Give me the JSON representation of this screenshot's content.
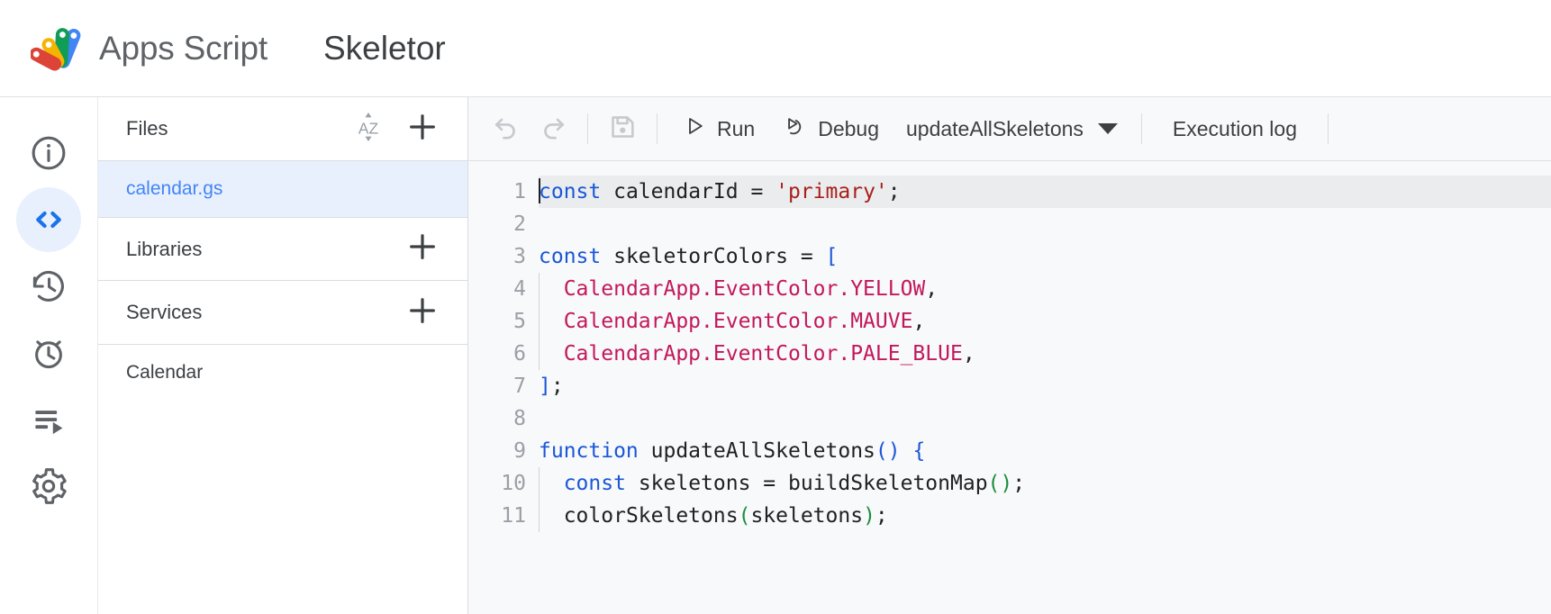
{
  "header": {
    "logo_icon": "apps-script-logo",
    "brand": "Apps Script",
    "project_title": "Skeletor",
    "logo_colors": {
      "red": "#DB4437",
      "yellow": "#F4B400",
      "green": "#0F9D58",
      "blue": "#4285F4"
    }
  },
  "rail": {
    "items": [
      {
        "icon": "info-icon",
        "name": "overview",
        "active": false
      },
      {
        "icon": "code-icon",
        "name": "editor",
        "active": true
      },
      {
        "icon": "history-icon",
        "name": "versions",
        "active": false
      },
      {
        "icon": "alarm-clock-icon",
        "name": "triggers",
        "active": false
      },
      {
        "icon": "executions-icon",
        "name": "executions",
        "active": false
      },
      {
        "icon": "gear-icon",
        "name": "settings",
        "active": false
      }
    ],
    "active_color": "#e8f0fe",
    "active_icon_color": "#1a73e8"
  },
  "files_panel": {
    "files_header": {
      "title": "Files",
      "sort_icon": "sort-az-icon",
      "add_icon": "plus-icon"
    },
    "files": [
      {
        "name": "calendar.gs",
        "selected": true
      }
    ],
    "libraries_header": {
      "title": "Libraries",
      "add_icon": "plus-icon"
    },
    "services_header": {
      "title": "Services",
      "add_icon": "plus-icon"
    },
    "services": [
      {
        "name": "Calendar"
      }
    ],
    "selected_bg": "#e8f0fe",
    "selected_fg": "#4285f4"
  },
  "toolbar": {
    "undo": {
      "label": "Undo",
      "icon": "undo-icon",
      "disabled": true
    },
    "redo": {
      "label": "Redo",
      "icon": "redo-icon",
      "disabled": true
    },
    "save": {
      "label": "Save project",
      "icon": "save-icon",
      "disabled": true
    },
    "run": {
      "label": "Run",
      "icon": "play-icon"
    },
    "debug": {
      "label": "Debug",
      "icon": "debug-icon"
    },
    "function_select": {
      "value": "updateAllSkeletons",
      "caret_icon": "chevron-down-icon"
    },
    "execution_log": {
      "label": "Execution log"
    }
  },
  "editor": {
    "background": "#f8f9fa",
    "active_line": 1,
    "cursor_line": 1,
    "cursor_col": 0,
    "line_numbers": [
      "1",
      "2",
      "3",
      "4",
      "5",
      "6",
      "7",
      "8",
      "9",
      "10",
      "11"
    ],
    "lines": [
      {
        "n": "1",
        "active": true,
        "indent": false,
        "cursor": true,
        "tokens": [
          {
            "t": "const",
            "c": "kw"
          },
          {
            "t": " ",
            "c": "pl"
          },
          {
            "t": "calendarId",
            "c": "id"
          },
          {
            "t": " = ",
            "c": "pl"
          },
          {
            "t": "'primary'",
            "c": "str"
          },
          {
            "t": ";",
            "c": "pl"
          }
        ]
      },
      {
        "n": "2",
        "active": false,
        "indent": false,
        "cursor": false,
        "tokens": []
      },
      {
        "n": "3",
        "active": false,
        "indent": false,
        "cursor": false,
        "tokens": [
          {
            "t": "const",
            "c": "kw"
          },
          {
            "t": " ",
            "c": "pl"
          },
          {
            "t": "skeletorColors",
            "c": "id"
          },
          {
            "t": " = ",
            "c": "pl"
          },
          {
            "t": "[",
            "c": "brk"
          }
        ]
      },
      {
        "n": "4",
        "active": false,
        "indent": true,
        "cursor": false,
        "tokens": [
          {
            "t": "  ",
            "c": "pl"
          },
          {
            "t": "CalendarApp.EventColor.YELLOW",
            "c": "prop"
          },
          {
            "t": ",",
            "c": "pl"
          }
        ]
      },
      {
        "n": "5",
        "active": false,
        "indent": true,
        "cursor": false,
        "tokens": [
          {
            "t": "  ",
            "c": "pl"
          },
          {
            "t": "CalendarApp.EventColor.MAUVE",
            "c": "prop"
          },
          {
            "t": ",",
            "c": "pl"
          }
        ]
      },
      {
        "n": "6",
        "active": false,
        "indent": true,
        "cursor": false,
        "tokens": [
          {
            "t": "  ",
            "c": "pl"
          },
          {
            "t": "CalendarApp.EventColor.PALE_BLUE",
            "c": "prop"
          },
          {
            "t": ",",
            "c": "pl"
          }
        ]
      },
      {
        "n": "7",
        "active": false,
        "indent": false,
        "cursor": false,
        "tokens": [
          {
            "t": "]",
            "c": "brk"
          },
          {
            "t": ";",
            "c": "pl"
          }
        ]
      },
      {
        "n": "8",
        "active": false,
        "indent": false,
        "cursor": false,
        "tokens": []
      },
      {
        "n": "9",
        "active": false,
        "indent": false,
        "cursor": false,
        "tokens": [
          {
            "t": "function",
            "c": "kw"
          },
          {
            "t": " ",
            "c": "pl"
          },
          {
            "t": "updateAllSkeletons",
            "c": "id"
          },
          {
            "t": "()",
            "c": "brk"
          },
          {
            "t": " ",
            "c": "pl"
          },
          {
            "t": "{",
            "c": "brk"
          }
        ]
      },
      {
        "n": "10",
        "active": false,
        "indent": true,
        "cursor": false,
        "tokens": [
          {
            "t": "  ",
            "c": "pl"
          },
          {
            "t": "const",
            "c": "kw"
          },
          {
            "t": " ",
            "c": "pl"
          },
          {
            "t": "skeletons",
            "c": "id"
          },
          {
            "t": " = ",
            "c": "pl"
          },
          {
            "t": "buildSkeletonMap",
            "c": "id"
          },
          {
            "t": "()",
            "c": "grn"
          },
          {
            "t": ";",
            "c": "pl"
          }
        ]
      },
      {
        "n": "11",
        "active": false,
        "indent": true,
        "cursor": false,
        "tokens": [
          {
            "t": "  ",
            "c": "pl"
          },
          {
            "t": "colorSkeletons",
            "c": "id"
          },
          {
            "t": "(",
            "c": "grn"
          },
          {
            "t": "skeletons",
            "c": "id"
          },
          {
            "t": ")",
            "c": "grn"
          },
          {
            "t": ";",
            "c": "pl"
          }
        ]
      }
    ],
    "syntax_colors": {
      "keyword": "#1a57d6",
      "identifier": "#202124",
      "string": "#a8201a",
      "property": "#c2185b",
      "bracket": "#1a57d6",
      "bracket_match": "#1e8e3e"
    }
  }
}
